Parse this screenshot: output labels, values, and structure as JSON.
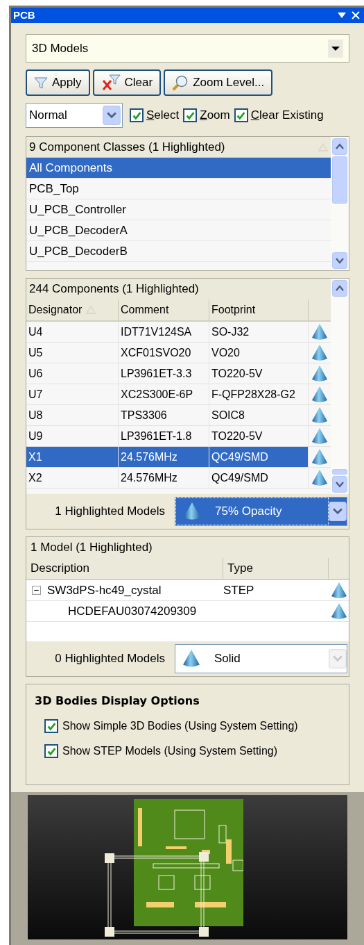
{
  "window": {
    "title": "PCB"
  },
  "mode_select": {
    "value": "3D Models"
  },
  "buttons": [
    {
      "kind": "apply",
      "label": "Apply"
    },
    {
      "kind": "clear",
      "label": "Clear"
    },
    {
      "kind": "zoom",
      "label": "Zoom Level..."
    }
  ],
  "filter_mode": {
    "value": "Normal"
  },
  "filter_options": [
    {
      "label": "Select",
      "checked": true
    },
    {
      "label": "Zoom",
      "checked": true
    },
    {
      "label": "Clear Existing",
      "checked": true
    }
  ],
  "classes": {
    "header": "9 Component Classes (1 Highlighted)",
    "items": [
      {
        "label": "All Components",
        "selected": true
      },
      {
        "label": "PCB_Top",
        "selected": false
      },
      {
        "label": "U_PCB_Controller",
        "selected": false
      },
      {
        "label": "U_PCB_DecoderA",
        "selected": false
      },
      {
        "label": "U_PCB_DecoderB",
        "selected": false
      }
    ]
  },
  "components": {
    "header": "244 Components (1 Highlighted)",
    "columns": [
      "Designator",
      "Comment",
      "Footprint"
    ],
    "rows": [
      {
        "cells": [
          "U4",
          "IDT71V124SA",
          "SO-J32"
        ],
        "selected": false
      },
      {
        "cells": [
          "U5",
          "XCF01SVO20",
          "VO20"
        ],
        "selected": false
      },
      {
        "cells": [
          "U6",
          "LP3961ET-3.3",
          "TO220-5V"
        ],
        "selected": false
      },
      {
        "cells": [
          "U7",
          "XC2S300E-6P",
          "F-QFP28X28-G2"
        ],
        "selected": false
      },
      {
        "cells": [
          "U8",
          "TPS3306",
          "SOIC8"
        ],
        "selected": false
      },
      {
        "cells": [
          "U9",
          "LP3961ET-1.8",
          "TO220-5V"
        ],
        "selected": false
      },
      {
        "cells": [
          "X1",
          "24.576MHz",
          "QC49/SMD"
        ],
        "selected": true
      },
      {
        "cells": [
          "X2",
          "24.576MHz",
          "QC49/SMD"
        ],
        "selected": false
      }
    ]
  },
  "component_display": {
    "label": "1 Highlighted Models",
    "value": "75% Opacity",
    "active": true
  },
  "models": {
    "header": "1 Model (1 Highlighted)",
    "columns": [
      "Description",
      "Type"
    ],
    "items": [
      {
        "label": "SW3dPS-hc49_cystal",
        "type": "STEP",
        "expanded": true,
        "children": [
          {
            "label": "HCDEFAU03074209309"
          }
        ]
      }
    ]
  },
  "model_display": {
    "label": "0 Highlighted Models",
    "value": "Solid",
    "active": false
  },
  "display_options": {
    "title": "3D Bodies Display Options",
    "options": [
      {
        "label": "Show Simple 3D Bodies (Using System Setting)",
        "checked": true
      },
      {
        "label": "Show STEP Models (Using System Setting)",
        "checked": true
      }
    ]
  }
}
